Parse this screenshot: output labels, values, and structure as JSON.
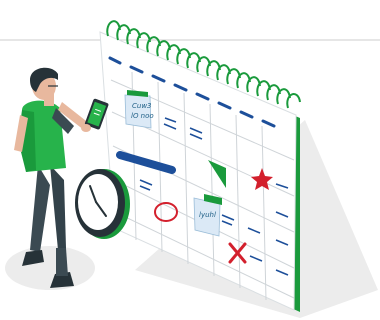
{
  "illustration": {
    "subject": "person with phone planning on large wall calendar",
    "icons": [
      "calendar-icon",
      "wall-clock-icon",
      "phone-icon",
      "star-icon",
      "cross-mark-icon",
      "circle-mark-icon"
    ],
    "colors": {
      "accent": "#1a9a3c",
      "accent_light": "#27b34b",
      "navy": "#1d4f9a",
      "red": "#d3202d",
      "sticky": "#dbe9f6",
      "grid_line": "#cfd4d8",
      "shadow": "#ececec",
      "skin": "#e8b89e",
      "hair": "#263238",
      "pants": "#3b4a52"
    },
    "sticky_notes": [
      {
        "text_line1": "Cuw3",
        "text_line2": "lO noo"
      },
      {
        "text_line1": "lyuhl",
        "text_line2": ""
      }
    ]
  }
}
